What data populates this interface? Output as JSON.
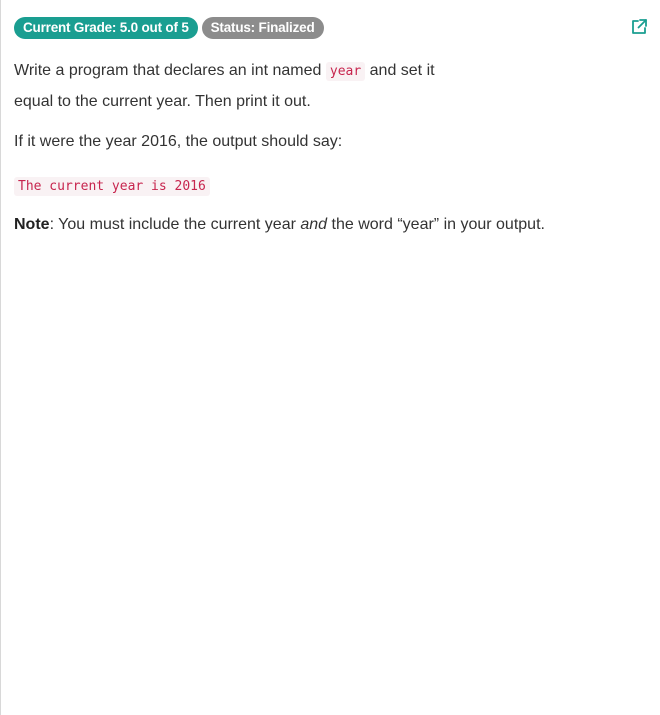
{
  "badges": {
    "grade": "Current Grade: 5.0 out of 5",
    "status": "Status: Finalized"
  },
  "icons": {
    "external_link": "external-link-icon",
    "accent_color": "#1a9e91"
  },
  "prompt": {
    "line1_before": "Write a program that declares an int named",
    "code_var": "year",
    "line1_after": "and set it equal to the current year. Then print it out.",
    "line2": "If it were the year 2016, the output should say:",
    "example_output": "The current year is 2016",
    "note_label": "Note",
    "note_part1": ": You must include the current year ",
    "note_emphasis": "and",
    "note_part2": " the word “year” in your output."
  }
}
